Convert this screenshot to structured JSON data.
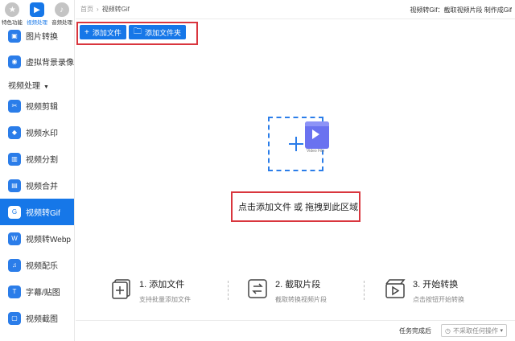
{
  "categories": [
    {
      "label": "特色功能",
      "icon": "star-icon"
    },
    {
      "label": "视频处理",
      "icon": "video-icon"
    },
    {
      "label": "音频处理",
      "icon": "audio-icon"
    }
  ],
  "sidebar": {
    "pre_items": [
      {
        "label": "图片转换",
        "icon": "image-convert-icon"
      },
      {
        "label": "虚拟背景录像",
        "icon": "virtual-bg-icon"
      }
    ],
    "section_title": "视频处理",
    "items": [
      {
        "label": "视频剪辑",
        "icon": "video-edit-icon"
      },
      {
        "label": "视频水印",
        "icon": "watermark-icon"
      },
      {
        "label": "视频分割",
        "icon": "split-icon"
      },
      {
        "label": "视频合并",
        "icon": "merge-icon"
      },
      {
        "label": "视频转Gif",
        "icon": "gif-icon"
      },
      {
        "label": "视频转Webp",
        "icon": "webp-icon"
      },
      {
        "label": "视频配乐",
        "icon": "music-icon"
      },
      {
        "label": "字幕/贴图",
        "icon": "subtitle-icon"
      },
      {
        "label": "视频截图",
        "icon": "screenshot-icon"
      }
    ]
  },
  "header": {
    "home": "首页",
    "current": "视频转Gif",
    "right_text": "视频转Gif：截取视频片段 制作成Gif"
  },
  "toolbar": {
    "add_file": "添加文件",
    "add_folder": "添加文件夹"
  },
  "dropzone": {
    "file_label": "Video File",
    "hint": "点击添加文件 或 拖拽到此区域"
  },
  "steps": [
    {
      "title": "1. 添加文件",
      "desc": "支持批量添加文件"
    },
    {
      "title": "2. 截取片段",
      "desc": "截取转换视频片段"
    },
    {
      "title": "3. 开始转换",
      "desc": "点击按钮开始转换"
    }
  ],
  "bottom": {
    "after_label": "任务完成后",
    "after_value": "不采取任何操作"
  },
  "colors": {
    "accent": "#1677e8",
    "highlight": "#d9363e"
  }
}
